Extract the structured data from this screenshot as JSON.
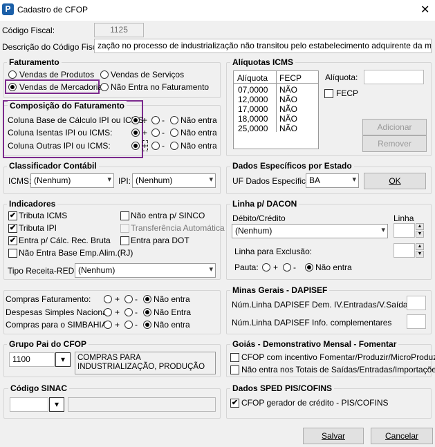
{
  "window": {
    "title": "Cadastro de CFOP",
    "close": "✕",
    "app_icon": "P"
  },
  "codigo_fiscal": {
    "label": "Código Fiscal:",
    "value": "1125"
  },
  "descricao": {
    "label": "Descrição do Código Fiscal:",
    "value": "zação no processo de industrialização não transitou pelo estabelecimento adquirente da mercadoria."
  },
  "faturamento": {
    "title": "Faturamento",
    "opt1": "Vendas de Produtos",
    "opt2": "Vendas de Serviços",
    "opt3": "Vendas de Mercadorias",
    "opt4": "Não Entra no Faturamento",
    "selected": "Vendas de Mercadorias"
  },
  "composicao": {
    "title": "Composição do Faturamento",
    "rows": [
      {
        "label": "Coluna Base de Cálculo IPI ou ICMS:",
        "selected": "+"
      },
      {
        "label": "Coluna Isentas IPI ou ICMS:",
        "selected": "Não entra"
      },
      {
        "label": "Coluna Outras IPI ou ICMS:",
        "selected": "+"
      }
    ],
    "plus": "+",
    "minus": "-",
    "none": "Não entra"
  },
  "aliquotas": {
    "title": "Alíquotas ICMS",
    "col1": "Alíquota",
    "col2": "FECP",
    "rows": [
      {
        "a": "07,0000",
        "f": "NÃO"
      },
      {
        "a": "12,0000",
        "f": "NÃO"
      },
      {
        "a": "17,0000",
        "f": "NÃO"
      },
      {
        "a": "18,0000",
        "f": "NÃO"
      },
      {
        "a": "25,0000",
        "f": "NÃO"
      }
    ],
    "aliquota_label": "Alíquota:",
    "aliquota_value": "",
    "fecp_label": "FECP",
    "add": "Adicionar",
    "remove": "Remover"
  },
  "classificador": {
    "title": "Classificador Contábil",
    "icms_label": "ICMS:",
    "icms_value": "(Nenhum)",
    "ipi_label": "IPI:",
    "ipi_value": "(Nenhum)"
  },
  "dados_estado": {
    "title": "Dados Específicos por Estado",
    "uf_label": "UF Dados Específicos:",
    "uf_value": "BA",
    "ok": "OK"
  },
  "indicadores": {
    "title": "Indicadores",
    "items": [
      {
        "label": "Tributa ICMS",
        "checked": true,
        "enabled": true
      },
      {
        "label": "Tributa IPI",
        "checked": true,
        "enabled": true
      },
      {
        "label": "Entra p/ Cálc. Rec. Bruta",
        "checked": true,
        "enabled": true
      },
      {
        "label": "Não Entra Base Emp.Alim.(RJ)",
        "checked": false,
        "enabled": true
      },
      {
        "label": "Não entra p/ SINCO",
        "checked": false,
        "enabled": true
      },
      {
        "label": "Transferência Automática",
        "checked": false,
        "enabled": false
      },
      {
        "label": "Entra para DOT",
        "checked": false,
        "enabled": true
      }
    ],
    "tipo_label": "Tipo Receita-REDF:",
    "tipo_value": "(Nenhum)"
  },
  "dacon": {
    "title": "Linha p/ DACON",
    "debcred_label": "Débito/Crédito",
    "debcred_value": "(Nenhum)",
    "linha_label": "Linha",
    "linha_value": "",
    "exclusao_label": "Linha para Exclusão:",
    "exclusao_value": "",
    "pauta_label": "Pauta:",
    "plus": "+",
    "minus": "-",
    "none": "Não entra",
    "pauta_selected": "Não entra"
  },
  "compras": {
    "rows": [
      {
        "label": "Compras Faturamento:",
        "selected": "Não entra"
      },
      {
        "label": "Despesas Simples Nacional:",
        "selected": "Não Entra"
      },
      {
        "label": "Compras para o SIMBAHIA:",
        "selected": "Não entra"
      }
    ],
    "plus": "+",
    "minus": "-"
  },
  "minas": {
    "title": "Minas Gerais - DAPISEF",
    "row1": "Núm.Linha DAPISEF Dem. IV.Entradas/V.Saídas",
    "row2": "Núm.Linha DAPISEF Info. complementares",
    "v1": "",
    "v2": ""
  },
  "grupo_pai": {
    "title": "Grupo Pai do CFOP",
    "code": "1100",
    "desc": "COMPRAS PARA\nINDUSTRIALIZAÇÃO, PRODUÇÃO"
  },
  "goias": {
    "title": "Goiás - Demonstrativo Mensal - Fomentar",
    "chk1": "CFOP com incentivo  Fomentar/Produzir/MicroProduzir",
    "chk2": "Não entra nos Totais de  Saídas/Entradas/Importações"
  },
  "sinac": {
    "title": "Código SINAC",
    "value": "",
    "desc": ""
  },
  "sped": {
    "title": "Dados SPED PIS/COFINS",
    "chk": "CFOP gerador de crédito - PIS/COFINS",
    "checked": true
  },
  "buttons": {
    "save": "Salvar",
    "cancel": "Cancelar"
  },
  "icons": {
    "dropdown": "▾",
    "check": "✔",
    "up": "▲",
    "down": "▼"
  },
  "colors": {
    "highlight": "#7b2a8d",
    "app_icon": "#1b5fa8"
  }
}
